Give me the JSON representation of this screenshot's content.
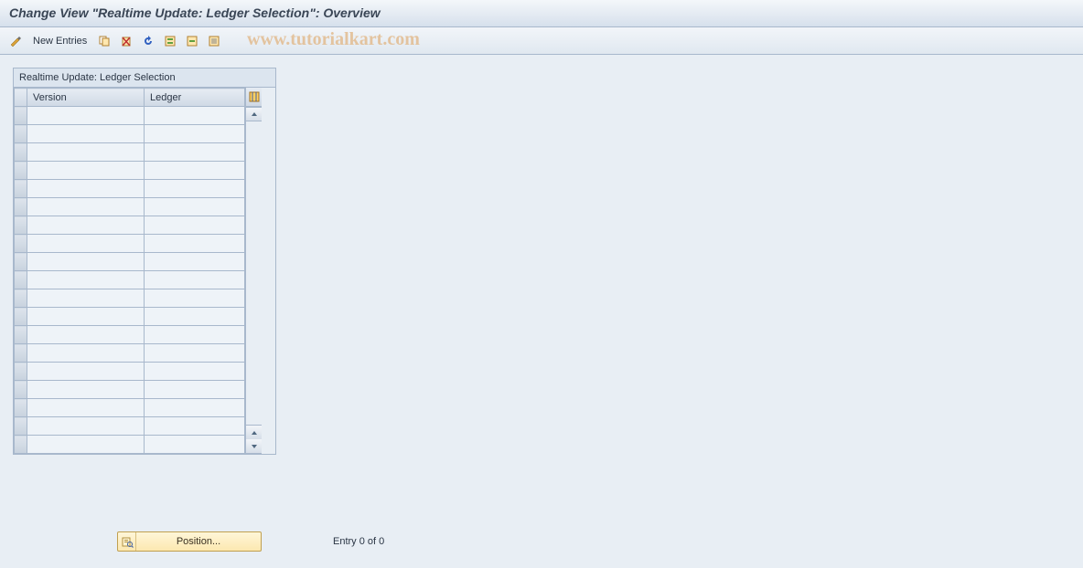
{
  "title": "Change View \"Realtime Update: Ledger Selection\": Overview",
  "toolbar": {
    "new_entries_label": "New Entries"
  },
  "watermark": "www.tutorialkart.com",
  "table": {
    "caption": "Realtime Update: Ledger Selection",
    "columns": {
      "version": "Version",
      "ledger": "Ledger"
    }
  },
  "footer": {
    "position_label": "Position...",
    "entry_label": "Entry 0 of 0"
  }
}
